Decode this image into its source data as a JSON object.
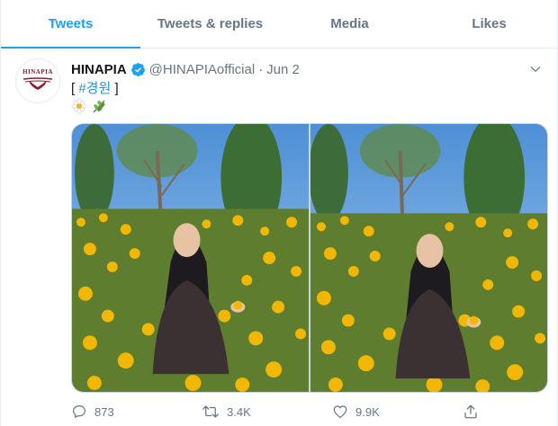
{
  "tabs": [
    {
      "label": "Tweets",
      "active": true
    },
    {
      "label": "Tweets & replies",
      "active": false
    },
    {
      "label": "Media",
      "active": false
    },
    {
      "label": "Likes",
      "active": false
    }
  ],
  "tweet": {
    "avatar_text": "HINAPIA",
    "display_name": "HINAPIA",
    "verified": true,
    "handle": "@HINAPIAofficial",
    "separator": "·",
    "date": "Jun 2",
    "text_open": "[ ",
    "hashtag": "#경원",
    "text_close": " ]",
    "emojis": [
      "daisy",
      "herb"
    ],
    "photos": 2,
    "actions": {
      "replies": "873",
      "retweets": "3.4K",
      "likes": "9.9K"
    }
  },
  "colors": {
    "accent": "#1da1f2",
    "secondary_text": "#657786",
    "border": "#e6ecf0",
    "logo": "#8b1c2c"
  },
  "icons": {
    "verified": "verified-badge-icon",
    "caret": "chevron-down-icon",
    "reply": "reply-icon",
    "retweet": "retweet-icon",
    "like": "heart-icon",
    "share": "share-icon"
  }
}
